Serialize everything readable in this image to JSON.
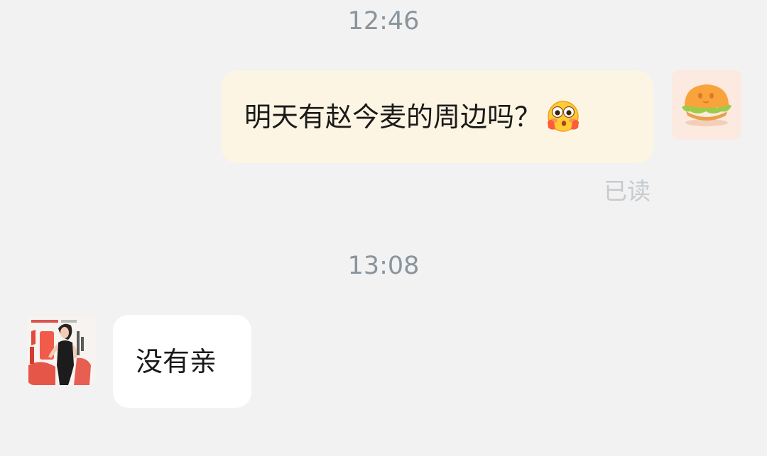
{
  "chat": {
    "messages": [
      {
        "timestamp": "12:46",
        "sender": "me",
        "text": "明天有赵今麦的周边吗？",
        "emoji": "flushed-face-emoji",
        "status": "已读"
      },
      {
        "timestamp": "13:08",
        "sender": "other",
        "text": "没有亲"
      }
    ]
  },
  "colors": {
    "background": "#f2f2f2",
    "outgoing_bubble": "#fdf5e3",
    "incoming_bubble": "#ffffff",
    "timestamp_text": "#8a949c",
    "read_status_text": "#c6cbcf"
  },
  "avatars": {
    "me": "burger-avatar",
    "other": "shop-promo-avatar"
  }
}
